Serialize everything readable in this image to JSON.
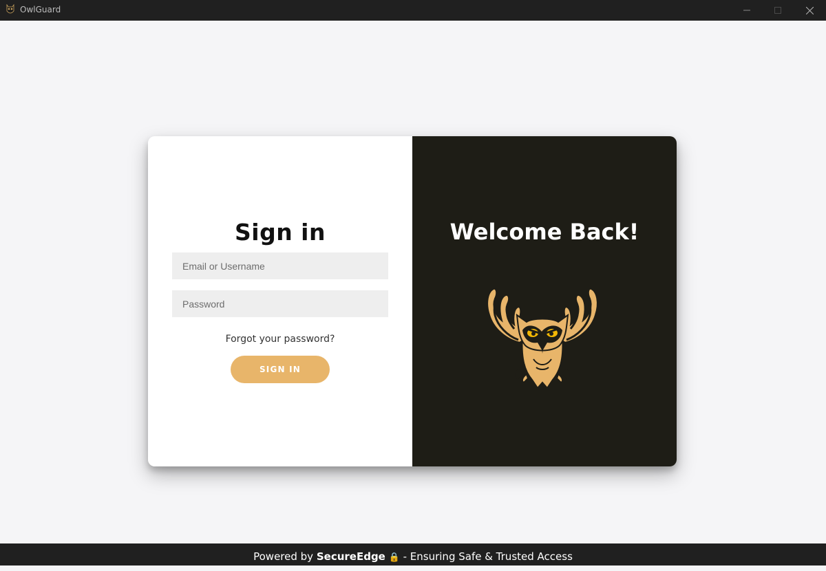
{
  "window": {
    "title": "OwlGuard",
    "icon": "owl-app-icon",
    "controls": [
      "minimize",
      "maximize",
      "close"
    ]
  },
  "login": {
    "title": "Sign in",
    "email_placeholder": "Email or Username",
    "password_placeholder": "Password",
    "forgot_label": "Forgot your password?",
    "submit_label": "SIGN IN"
  },
  "welcome": {
    "title": "Welcome Back!",
    "image": "owl-illustration"
  },
  "footer": {
    "prefix": "Powered by",
    "brand": "SecureEdge",
    "lock_icon": "🔒",
    "suffix": "- Ensuring Safe & Trusted Access"
  },
  "colors": {
    "accent": "#e8b56a",
    "dark_panel": "#1e1d16",
    "titlebar": "#202020",
    "background": "#f5f5f7"
  }
}
